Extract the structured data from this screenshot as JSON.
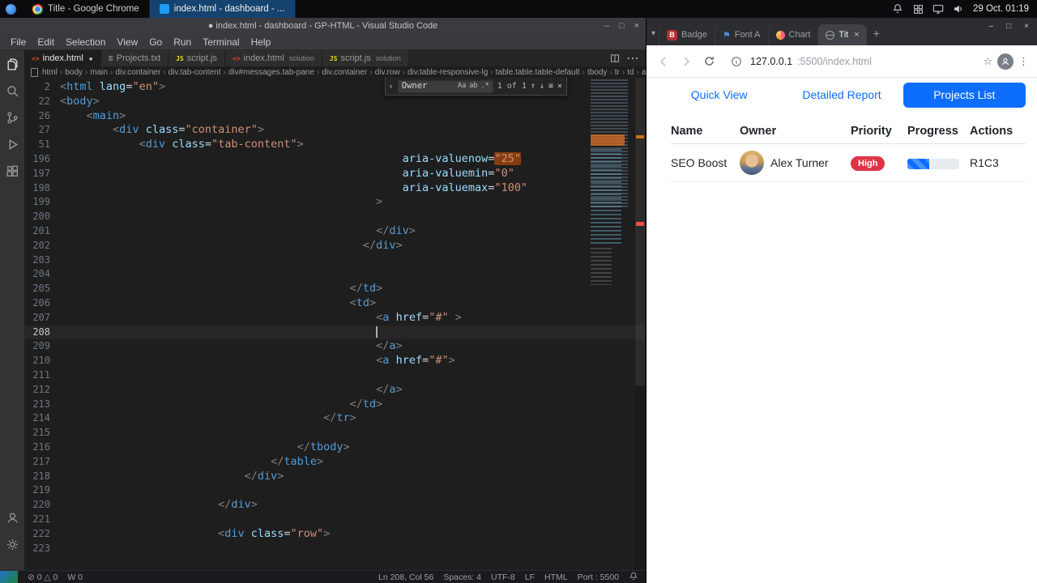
{
  "taskbar": {
    "windows": [
      {
        "title": "Title - Google Chrome",
        "icon": "chrome",
        "active": false
      },
      {
        "title": "index.html - dashboard - ...",
        "icon": "vscode",
        "active": true
      }
    ],
    "clock": "29 Oct. 01:19"
  },
  "icons": {
    "minimize": "–",
    "maximize": "□",
    "close": "×",
    "more": "⋯",
    "menu_dots": "⋮",
    "new_tab": "+",
    "caret_down": "▾",
    "find_chevron": "›",
    "prev": "↑",
    "next": "↓",
    "in_selection": "≡",
    "modified_dot": "●",
    "html_file": "<>",
    "js_file": "JS",
    "txt_file": "≡",
    "bootstrap_b": "B",
    "flag": "⚑",
    "star": "☆"
  },
  "vscode": {
    "window_title": "● index.html - dashboard - GP-HTML - Visual Studio Code",
    "menu": [
      "File",
      "Edit",
      "Selection",
      "View",
      "Go",
      "Run",
      "Terminal",
      "Help"
    ],
    "tabs": [
      {
        "name": "index.html",
        "folder": "",
        "icon": "html",
        "modified": true,
        "active": true
      },
      {
        "name": "Projects.txt",
        "folder": "",
        "icon": "txt",
        "modified": false,
        "active": false
      },
      {
        "name": "script.js",
        "folder": "",
        "icon": "js",
        "modified": false,
        "active": false
      },
      {
        "name": "index.html",
        "folder": "solution",
        "icon": "html",
        "modified": false,
        "active": false
      },
      {
        "name": "script.js",
        "folder": "solution",
        "icon": "js",
        "modified": false,
        "active": false
      }
    ],
    "breadcrumbs": [
      "html",
      "body",
      "main",
      "div.container",
      "div.tab-content",
      "div#messages.tab-pane",
      "div.container",
      "div.row",
      "div.table-responsive-lg",
      "table.table.table-default",
      "tbody",
      "tr",
      "td",
      "a"
    ],
    "find": {
      "value": "Owner",
      "results": "1 of 1",
      "match_case": "Aa",
      "whole_word": "ab",
      "regex": ".*"
    },
    "code_lines": [
      {
        "n": "2",
        "i": 0,
        "t": [
          [
            "p",
            "<"
          ],
          [
            "t",
            "html"
          ],
          [
            "w",
            " "
          ],
          [
            "a",
            "lang"
          ],
          [
            "o",
            "="
          ],
          [
            "s",
            "\"en\""
          ],
          [
            "p",
            ">"
          ]
        ]
      },
      {
        "n": "22",
        "i": 0,
        "t": [
          [
            "p",
            "<"
          ],
          [
            "t",
            "body"
          ],
          [
            "p",
            ">"
          ]
        ]
      },
      {
        "n": "26",
        "i": 4,
        "t": [
          [
            "p",
            "<"
          ],
          [
            "t",
            "main"
          ],
          [
            "p",
            ">"
          ]
        ]
      },
      {
        "n": "27",
        "i": 8,
        "t": [
          [
            "p",
            "<"
          ],
          [
            "t",
            "div"
          ],
          [
            "w",
            " "
          ],
          [
            "a",
            "class"
          ],
          [
            "o",
            "="
          ],
          [
            "s",
            "\"container\""
          ],
          [
            "p",
            ">"
          ]
        ]
      },
      {
        "n": "51",
        "i": 12,
        "t": [
          [
            "p",
            "<"
          ],
          [
            "t",
            "div"
          ],
          [
            "w",
            " "
          ],
          [
            "a",
            "class"
          ],
          [
            "o",
            "="
          ],
          [
            "s",
            "\"tab-content\""
          ],
          [
            "p",
            ">"
          ]
        ]
      },
      {
        "n": "196",
        "i": 52,
        "t": [
          [
            "a",
            "aria-valuenow"
          ],
          [
            "o",
            "="
          ],
          [
            "sh",
            "\"25\""
          ]
        ]
      },
      {
        "n": "197",
        "i": 52,
        "t": [
          [
            "a",
            "aria-valuemin"
          ],
          [
            "o",
            "="
          ],
          [
            "s",
            "\"0\""
          ]
        ]
      },
      {
        "n": "198",
        "i": 52,
        "t": [
          [
            "a",
            "aria-valuemax"
          ],
          [
            "o",
            "="
          ],
          [
            "s",
            "\"100\""
          ]
        ]
      },
      {
        "n": "199",
        "i": 48,
        "t": [
          [
            "p",
            ">"
          ]
        ]
      },
      {
        "n": "200",
        "i": 0,
        "t": []
      },
      {
        "n": "201",
        "i": 48,
        "t": [
          [
            "p",
            "</"
          ],
          [
            "t",
            "div"
          ],
          [
            "p",
            ">"
          ]
        ]
      },
      {
        "n": "202",
        "i": 46,
        "t": [
          [
            "p",
            "</"
          ],
          [
            "t",
            "div"
          ],
          [
            "p",
            ">"
          ]
        ]
      },
      {
        "n": "203",
        "i": 0,
        "t": []
      },
      {
        "n": "204",
        "i": 0,
        "t": []
      },
      {
        "n": "205",
        "i": 44,
        "t": [
          [
            "p",
            "</"
          ],
          [
            "t",
            "td"
          ],
          [
            "p",
            ">"
          ]
        ]
      },
      {
        "n": "206",
        "i": 44,
        "t": [
          [
            "p",
            "<"
          ],
          [
            "t",
            "td"
          ],
          [
            "p",
            ">"
          ]
        ]
      },
      {
        "n": "207",
        "i": 48,
        "t": [
          [
            "p",
            "<"
          ],
          [
            "t",
            "a"
          ],
          [
            "w",
            " "
          ],
          [
            "a",
            "href"
          ],
          [
            "o",
            "="
          ],
          [
            "s",
            "\"#\""
          ],
          [
            "w",
            " "
          ],
          [
            "p",
            ">"
          ]
        ]
      },
      {
        "n": "208",
        "i": 48,
        "t": [],
        "c": true
      },
      {
        "n": "209",
        "i": 48,
        "t": [
          [
            "p",
            "</"
          ],
          [
            "t",
            "a"
          ],
          [
            "p",
            ">"
          ]
        ]
      },
      {
        "n": "210",
        "i": 48,
        "t": [
          [
            "p",
            "<"
          ],
          [
            "t",
            "a"
          ],
          [
            "w",
            " "
          ],
          [
            "a",
            "href"
          ],
          [
            "o",
            "="
          ],
          [
            "s",
            "\"#\""
          ],
          [
            "p",
            ">"
          ]
        ]
      },
      {
        "n": "211",
        "i": 0,
        "t": []
      },
      {
        "n": "212",
        "i": 48,
        "t": [
          [
            "p",
            "</"
          ],
          [
            "t",
            "a"
          ],
          [
            "p",
            ">"
          ]
        ]
      },
      {
        "n": "213",
        "i": 44,
        "t": [
          [
            "p",
            "</"
          ],
          [
            "t",
            "td"
          ],
          [
            "p",
            ">"
          ]
        ]
      },
      {
        "n": "214",
        "i": 40,
        "t": [
          [
            "p",
            "</"
          ],
          [
            "t",
            "tr"
          ],
          [
            "p",
            ">"
          ]
        ]
      },
      {
        "n": "215",
        "i": 0,
        "t": []
      },
      {
        "n": "216",
        "i": 36,
        "t": [
          [
            "p",
            "</"
          ],
          [
            "t",
            "tbody"
          ],
          [
            "p",
            ">"
          ]
        ]
      },
      {
        "n": "217",
        "i": 32,
        "t": [
          [
            "p",
            "</"
          ],
          [
            "t",
            "table"
          ],
          [
            "p",
            ">"
          ]
        ]
      },
      {
        "n": "218",
        "i": 28,
        "t": [
          [
            "p",
            "</"
          ],
          [
            "t",
            "div"
          ],
          [
            "p",
            ">"
          ]
        ]
      },
      {
        "n": "219",
        "i": 0,
        "t": []
      },
      {
        "n": "220",
        "i": 24,
        "t": [
          [
            "p",
            "</"
          ],
          [
            "t",
            "div"
          ],
          [
            "p",
            ">"
          ]
        ]
      },
      {
        "n": "221",
        "i": 0,
        "t": []
      },
      {
        "n": "222",
        "i": 24,
        "t": [
          [
            "p",
            "<"
          ],
          [
            "t",
            "div"
          ],
          [
            "w",
            " "
          ],
          [
            "a",
            "class"
          ],
          [
            "o",
            "="
          ],
          [
            "s",
            "\"row\""
          ],
          [
            "p",
            ">"
          ]
        ]
      },
      {
        "n": "223",
        "i": 0,
        "t": []
      }
    ],
    "status": {
      "problems": "⊘ 0  △ 0",
      "w": "W 0",
      "line_col": "Ln 208, Col 56",
      "spaces": "Spaces: 4",
      "encoding": "UTF-8",
      "eol": "LF",
      "lang": "HTML",
      "port": "Port : 5500"
    }
  },
  "chrome": {
    "tabs": [
      {
        "label": "Badge",
        "icon": "bootstrap",
        "active": false
      },
      {
        "label": "Font A",
        "icon": "fontawesome",
        "active": false
      },
      {
        "label": "Chart",
        "icon": "chart",
        "active": false
      },
      {
        "label": "Tit",
        "icon": "globe",
        "active": true
      }
    ],
    "url_host": "127.0.0.1",
    "url_rest": ":5500/index.html",
    "nav_pills": [
      {
        "label": "Quick View",
        "active": false
      },
      {
        "label": "Detailed Report",
        "active": false
      },
      {
        "label": "Projects List",
        "active": true
      }
    ],
    "table": {
      "headers": [
        "Name",
        "Owner",
        "Priority",
        "Progress",
        "Actions"
      ],
      "rows": [
        {
          "name": "SEO Boost",
          "owner": "Alex Turner",
          "priority": "High",
          "progress_percent": 42,
          "actions": "R1C3"
        }
      ]
    },
    "colors": {
      "accent": "#0d6efd",
      "danger": "#dc3545"
    }
  }
}
